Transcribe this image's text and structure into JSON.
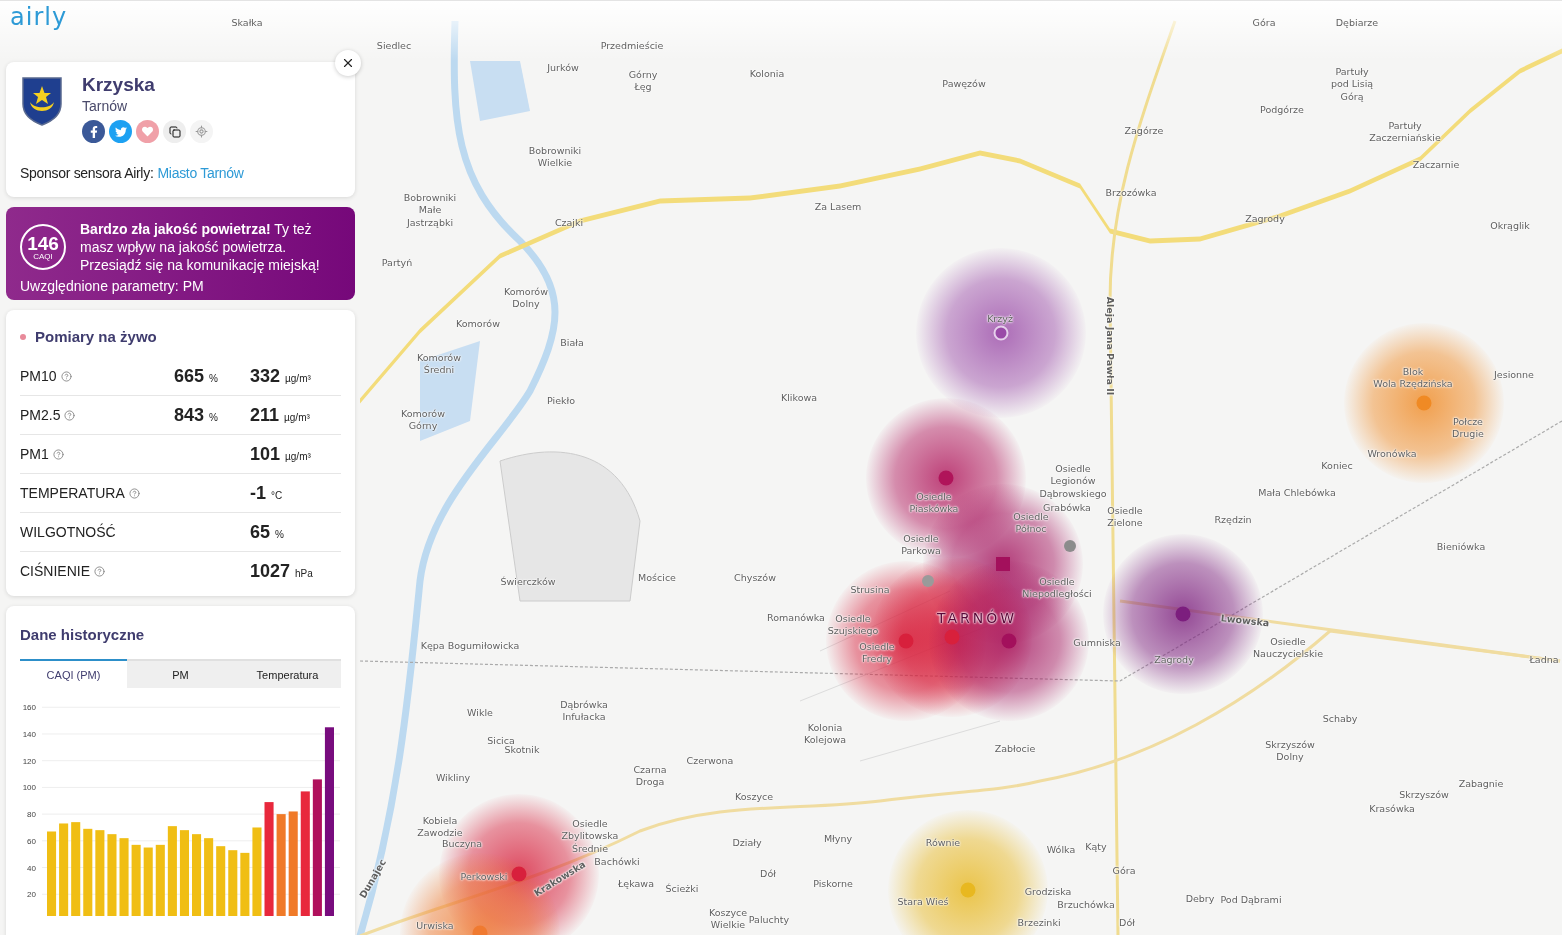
{
  "logo": "airly",
  "location": {
    "name": "Krzyska",
    "city": "Tarnów",
    "sponsor_label": "Sponsor sensora Airly:",
    "sponsor_link": "Miasto Tarnów"
  },
  "alert": {
    "caqi": "146",
    "caqi_label": "CAQI",
    "message": "**Bardzo zła jakość powietrza!** Ty też masz wpływ na jakość powietrza. Przesiądź się na komunikację miejską!",
    "params": "Uwzględnione parametry: PM"
  },
  "live": {
    "title": "Pomiary na żywo",
    "rows": [
      {
        "label": "PM10",
        "help": true,
        "percent": "665",
        "percent_unit": "%",
        "value": "332",
        "unit": "µg/m³"
      },
      {
        "label": "PM2.5",
        "help": true,
        "percent": "843",
        "percent_unit": "%",
        "value": "211",
        "unit": "µg/m³"
      },
      {
        "label": "PM1",
        "help": true,
        "value": "101",
        "unit": "µg/m³"
      },
      {
        "label": "TEMPERATURA",
        "help": true,
        "value": "-1",
        "unit": "°C"
      },
      {
        "label": "WILGOTNOŚĆ",
        "help": false,
        "value": "65",
        "unit": "%"
      },
      {
        "label": "CIŚNIENIE",
        "help": true,
        "value": "1027",
        "unit": "hPa"
      }
    ]
  },
  "history": {
    "title": "Dane historyczne",
    "tabs": [
      {
        "label": "CAQI (PM)",
        "selected": true
      },
      {
        "label": "PM",
        "selected": false
      },
      {
        "label": "Temperatura",
        "selected": false
      }
    ],
    "chart_data": {
      "type": "bar",
      "ylim": [
        0,
        160
      ],
      "yticks": [
        20,
        40,
        60,
        80,
        100,
        120,
        140,
        160
      ],
      "grid": true,
      "values": [
        67,
        73,
        74,
        69,
        68,
        65,
        62,
        57,
        55,
        57,
        71,
        68,
        65,
        62,
        56,
        53,
        51,
        70,
        89,
        80,
        82,
        97,
        106,
        145
      ]
    }
  },
  "map": {
    "labels": [
      {
        "text": "Skałka",
        "kind": "place"
      },
      {
        "text": "Góra",
        "kind": "place"
      },
      {
        "text": "Dębiarze",
        "kind": "place"
      },
      {
        "text": "Siedlec",
        "kind": "place"
      },
      {
        "text": "Przedmieście",
        "kind": "place"
      },
      {
        "text": "Jurków",
        "kind": "place"
      },
      {
        "text": "Górny\nŁęg",
        "kind": "place"
      },
      {
        "text": "Kolonia",
        "kind": "place"
      },
      {
        "text": "Pawęzów",
        "kind": "place"
      },
      {
        "text": "Partuły\npod Lisią\nGórą",
        "kind": "place"
      },
      {
        "text": "Podgórze",
        "kind": "place"
      },
      {
        "text": "Zagórze",
        "kind": "place"
      },
      {
        "text": "Bobrowniki\nWielkie",
        "kind": "place"
      },
      {
        "text": "Partuły\nZaczerniańskie",
        "kind": "place"
      },
      {
        "text": "Zaczarnie",
        "kind": "place"
      },
      {
        "text": "Bobrowniki\nMałe\nJastrząbki",
        "kind": "place"
      },
      {
        "text": "Brzozówka",
        "kind": "place"
      },
      {
        "text": "Za Lasem",
        "kind": "place"
      },
      {
        "text": "Czajki",
        "kind": "place"
      },
      {
        "text": "Zagrody",
        "kind": "place"
      },
      {
        "text": "Okrąglik",
        "kind": "place"
      },
      {
        "text": "Partyń",
        "kind": "place"
      },
      {
        "text": "Komorów\nDolny",
        "kind": "place"
      },
      {
        "text": "Komorów",
        "kind": "place"
      },
      {
        "text": "Krzyż",
        "kind": "place"
      },
      {
        "text": "Biała",
        "kind": "place"
      },
      {
        "text": "Komorów\nŚredni",
        "kind": "place"
      },
      {
        "text": "Aleja Jana Pawła II",
        "kind": "street"
      },
      {
        "text": "Blok\nWola Rzędzińska",
        "kind": "place"
      },
      {
        "text": "Jesionne",
        "kind": "place"
      },
      {
        "text": "Piekło",
        "kind": "place"
      },
      {
        "text": "Klikowa",
        "kind": "place"
      },
      {
        "text": "Komorów\nGórny",
        "kind": "place"
      },
      {
        "text": "Połcze\nDrugie",
        "kind": "place"
      },
      {
        "text": "Wronówka",
        "kind": "place"
      },
      {
        "text": "Osiedle\nLegionów\nDąbrowskiego",
        "kind": "place"
      },
      {
        "text": "Koniec",
        "kind": "place"
      },
      {
        "text": "Osiedle\nPiaskówka",
        "kind": "place"
      },
      {
        "text": "Mała Chlebówka",
        "kind": "place"
      },
      {
        "text": "Osiedle\nPółnoc",
        "kind": "place"
      },
      {
        "text": "Grabówka",
        "kind": "place"
      },
      {
        "text": "Osiedle\nZielone",
        "kind": "place"
      },
      {
        "text": "Rzędzin",
        "kind": "place"
      },
      {
        "text": "Osiedle\nParkowa",
        "kind": "place"
      },
      {
        "text": "Bieniówka",
        "kind": "place"
      },
      {
        "text": "Świerczków",
        "kind": "place"
      },
      {
        "text": "Mościce",
        "kind": "place"
      },
      {
        "text": "Chyszów",
        "kind": "place"
      },
      {
        "text": "Strusina",
        "kind": "place"
      },
      {
        "text": "Osiedle\nNiepodległości",
        "kind": "place"
      },
      {
        "text": "Romanówka",
        "kind": "place"
      },
      {
        "text": "Osiedle\nSzujskiego",
        "kind": "place"
      },
      {
        "text": "TARNÓW",
        "kind": "city"
      },
      {
        "text": "Lwowska",
        "kind": "street"
      },
      {
        "text": "Kępa Bogumiłowicka",
        "kind": "place"
      },
      {
        "text": "Osiedle\nFredry",
        "kind": "place"
      },
      {
        "text": "Gumniska",
        "kind": "place"
      },
      {
        "text": "Zagrody",
        "kind": "place"
      },
      {
        "text": "Osiedle\nNauczycielskie",
        "kind": "place"
      },
      {
        "text": "Ładna",
        "kind": "place"
      },
      {
        "text": "Wikle",
        "kind": "place"
      },
      {
        "text": "Dąbrówka\nInfułacka",
        "kind": "place"
      },
      {
        "text": "Schaby",
        "kind": "place"
      },
      {
        "text": "Sicica",
        "kind": "place"
      },
      {
        "text": "Kolonia\nKolejowa",
        "kind": "place"
      },
      {
        "text": "Skotnik",
        "kind": "place"
      },
      {
        "text": "Zabłocie",
        "kind": "place"
      },
      {
        "text": "Czerwona",
        "kind": "place"
      },
      {
        "text": "Skrzyszów\nDolny",
        "kind": "place"
      },
      {
        "text": "Wikliny",
        "kind": "place"
      },
      {
        "text": "Czarna\nDroga",
        "kind": "place"
      },
      {
        "text": "Zabagnie",
        "kind": "place"
      },
      {
        "text": "Koszyce",
        "kind": "place"
      },
      {
        "text": "Skrzyszów",
        "kind": "place"
      },
      {
        "text": "Krasówka",
        "kind": "place"
      },
      {
        "text": "Kobiela\nZawodzie",
        "kind": "place"
      },
      {
        "text": "Buczyna",
        "kind": "place"
      },
      {
        "text": "Osiedle\nZbylitowska\nŚrednie",
        "kind": "place"
      },
      {
        "text": "Działy",
        "kind": "place"
      },
      {
        "text": "Młyny",
        "kind": "place"
      },
      {
        "text": "Równie",
        "kind": "place"
      },
      {
        "text": "Wólka",
        "kind": "place"
      },
      {
        "text": "Kąty",
        "kind": "place"
      },
      {
        "text": "Dunajec",
        "kind": "street"
      },
      {
        "text": "Bachówki",
        "kind": "place"
      },
      {
        "text": "Perkowski",
        "kind": "place"
      },
      {
        "text": "Krakowska",
        "kind": "street"
      },
      {
        "text": "Dół",
        "kind": "place"
      },
      {
        "text": "Góra",
        "kind": "place"
      },
      {
        "text": "Łękawa",
        "kind": "place"
      },
      {
        "text": "Ścieżki",
        "kind": "place"
      },
      {
        "text": "Piskorne",
        "kind": "place"
      },
      {
        "text": "Grodziska",
        "kind": "place"
      },
      {
        "text": "Stara Wieś",
        "kind": "place"
      },
      {
        "text": "Brzuchówka",
        "kind": "place"
      },
      {
        "text": "Debry",
        "kind": "place"
      },
      {
        "text": "Pod Dąbrami",
        "kind": "place"
      },
      {
        "text": "Urwiska",
        "kind": "place"
      },
      {
        "text": "Koszyce\nWielkie",
        "kind": "place"
      },
      {
        "text": "Paluchty",
        "kind": "place"
      },
      {
        "text": "Brzezinki",
        "kind": "place"
      },
      {
        "text": "Dół",
        "kind": "place"
      }
    ],
    "sensors": [
      {
        "kind": "ring",
        "color": "#9a4aa8"
      },
      {
        "kind": "dot",
        "color": "#b0145a"
      },
      {
        "kind": "square",
        "color": "#a3105c"
      },
      {
        "kind": "inactive",
        "color": "#8c8c8c"
      },
      {
        "kind": "inactive",
        "color": "#9a9a9a"
      },
      {
        "kind": "dot",
        "color": "#d8203c"
      },
      {
        "kind": "dot",
        "color": "#d8203c"
      },
      {
        "kind": "dot",
        "color": "#a3105c"
      },
      {
        "kind": "dot",
        "color": "#7c1e7e"
      },
      {
        "kind": "dot",
        "color": "#f08a24"
      },
      {
        "kind": "dot",
        "color": "#d8203c"
      },
      {
        "kind": "dot",
        "color": "#f07a30"
      },
      {
        "kind": "dot",
        "color": "#e8b820"
      }
    ]
  }
}
